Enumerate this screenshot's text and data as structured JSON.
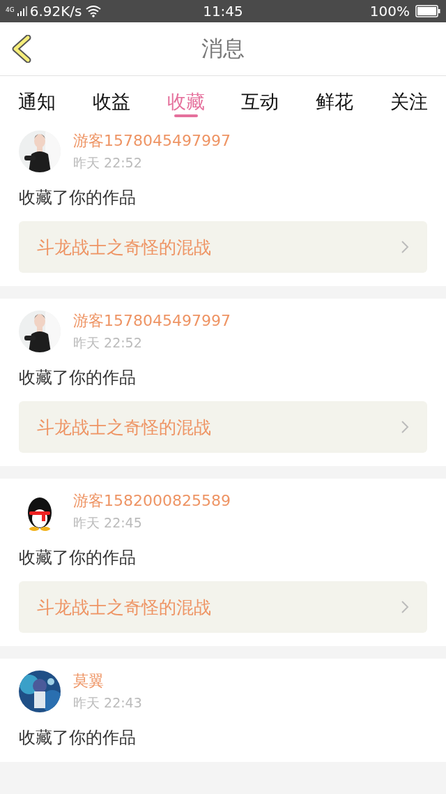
{
  "status_bar": {
    "network": "4G",
    "speed": "6.92K/s",
    "time": "11:45",
    "battery": "100%"
  },
  "header": {
    "title": "消息"
  },
  "tabs": [
    {
      "label": "通知",
      "selected": false
    },
    {
      "label": "收益",
      "selected": false
    },
    {
      "label": "收藏",
      "selected": true
    },
    {
      "label": "互动",
      "selected": false
    },
    {
      "label": "鲜花",
      "selected": false
    },
    {
      "label": "关注",
      "selected": false
    }
  ],
  "messages": [
    {
      "user": "游客1578045497997",
      "time": "昨天 22:52",
      "text": "收藏了你的作品",
      "work": "斗龙战士之奇怪的混战"
    },
    {
      "user": "游客1578045497997",
      "time": "昨天 22:52",
      "text": "收藏了你的作品",
      "work": "斗龙战士之奇怪的混战"
    },
    {
      "user": "游客1582000825589",
      "time": "昨天 22:45",
      "text": "收藏了你的作品",
      "work": "斗龙战士之奇怪的混战"
    },
    {
      "user": "莫翼",
      "time": "昨天 22:43",
      "text": "收藏了你的作品"
    }
  ]
}
